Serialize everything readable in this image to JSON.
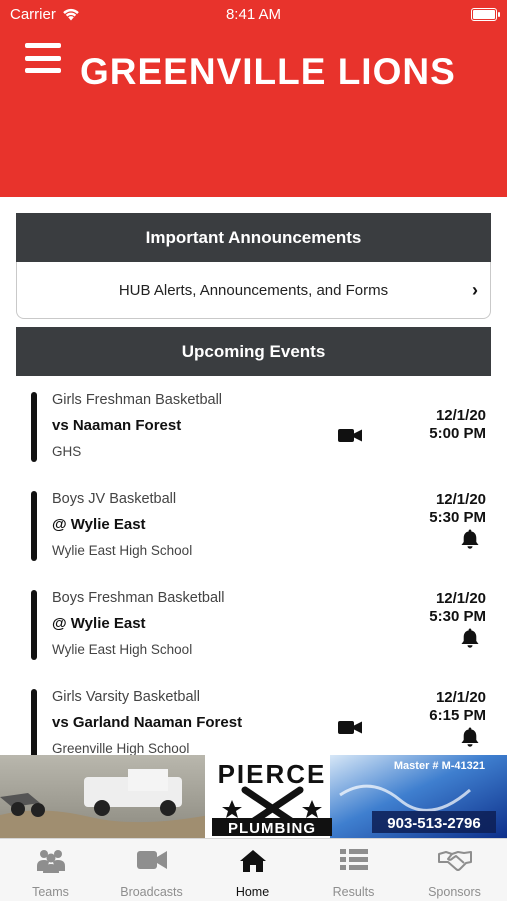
{
  "status_bar": {
    "carrier": "Carrier",
    "time": "8:41 AM"
  },
  "header": {
    "title": "GREENVILLE LIONS"
  },
  "announcements": {
    "heading": "Important Announcements",
    "link_label": "HUB Alerts, Announcements, and Forms"
  },
  "events": {
    "heading": "Upcoming Events",
    "items": [
      {
        "sport": "Girls Freshman Basketball",
        "opponent": "vs Naaman Forest",
        "location": "GHS",
        "date": "12/1/20",
        "time": "5:00 PM",
        "icon": "video-camera-icon"
      },
      {
        "sport": "Boys JV Basketball",
        "opponent": "@ Wylie East",
        "location": "Wylie East High School",
        "date": "12/1/20",
        "time": "5:30 PM",
        "icon": "bell-icon"
      },
      {
        "sport": "Boys Freshman Basketball",
        "opponent": "@ Wylie East",
        "location": "Wylie East High School",
        "date": "12/1/20",
        "time": "5:30 PM",
        "icon": "bell-icon"
      },
      {
        "sport": "Girls Varsity Basketball",
        "opponent": "vs Garland Naaman Forest",
        "location": "Greenville High School",
        "date": "12/1/20",
        "time": "6:15 PM",
        "icons": [
          "video-camera-icon",
          "bell-icon"
        ]
      }
    ]
  },
  "sponsor_ad": {
    "name": "PIERCE",
    "sub": "PLUMBING",
    "license": "Master # M-41321",
    "phone": "903-513-2796"
  },
  "tab_bar": {
    "active": "Home",
    "tabs": [
      {
        "label": "Teams",
        "icon": "teams-icon"
      },
      {
        "label": "Broadcasts",
        "icon": "video-camera-icon"
      },
      {
        "label": "Home",
        "icon": "home-icon"
      },
      {
        "label": "Results",
        "icon": "list-icon"
      },
      {
        "label": "Sponsors",
        "icon": "handshake-icon"
      }
    ]
  },
  "colors": {
    "brand_red": "#e8332c",
    "section_header": "#3a3d40"
  }
}
